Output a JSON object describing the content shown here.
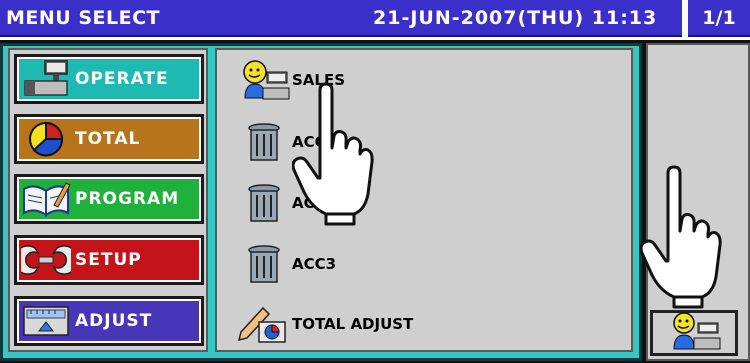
{
  "titlebar": {
    "title": "MENU SELECT",
    "datetime": "21-JUN-2007(THU) 11:13",
    "page": "1/1"
  },
  "categories": [
    {
      "label": "OPERATE",
      "icon": "register-icon",
      "color": "#1fb9b4"
    },
    {
      "label": "TOTAL",
      "icon": "pie-chart-icon",
      "color": "#b8741a"
    },
    {
      "label": "PROGRAM",
      "icon": "open-book-icon",
      "color": "#1fb13a"
    },
    {
      "label": "SETUP",
      "icon": "wrench-icon",
      "color": "#c4141a"
    },
    {
      "label": "ADJUST",
      "icon": "scale-icon",
      "color": "#4836b8"
    }
  ],
  "menu_items": [
    {
      "label": "SALES",
      "icon": "clerk-register-icon"
    },
    {
      "label": "ACC1",
      "icon": "trash-can-icon"
    },
    {
      "label": "ACC2",
      "icon": "trash-can-icon"
    },
    {
      "label": "ACC3",
      "icon": "trash-can-icon"
    },
    {
      "label": "TOTAL ADJUST",
      "icon": "pencil-chart-icon"
    }
  ],
  "side_button": {
    "icon": "clerk-register-icon"
  }
}
